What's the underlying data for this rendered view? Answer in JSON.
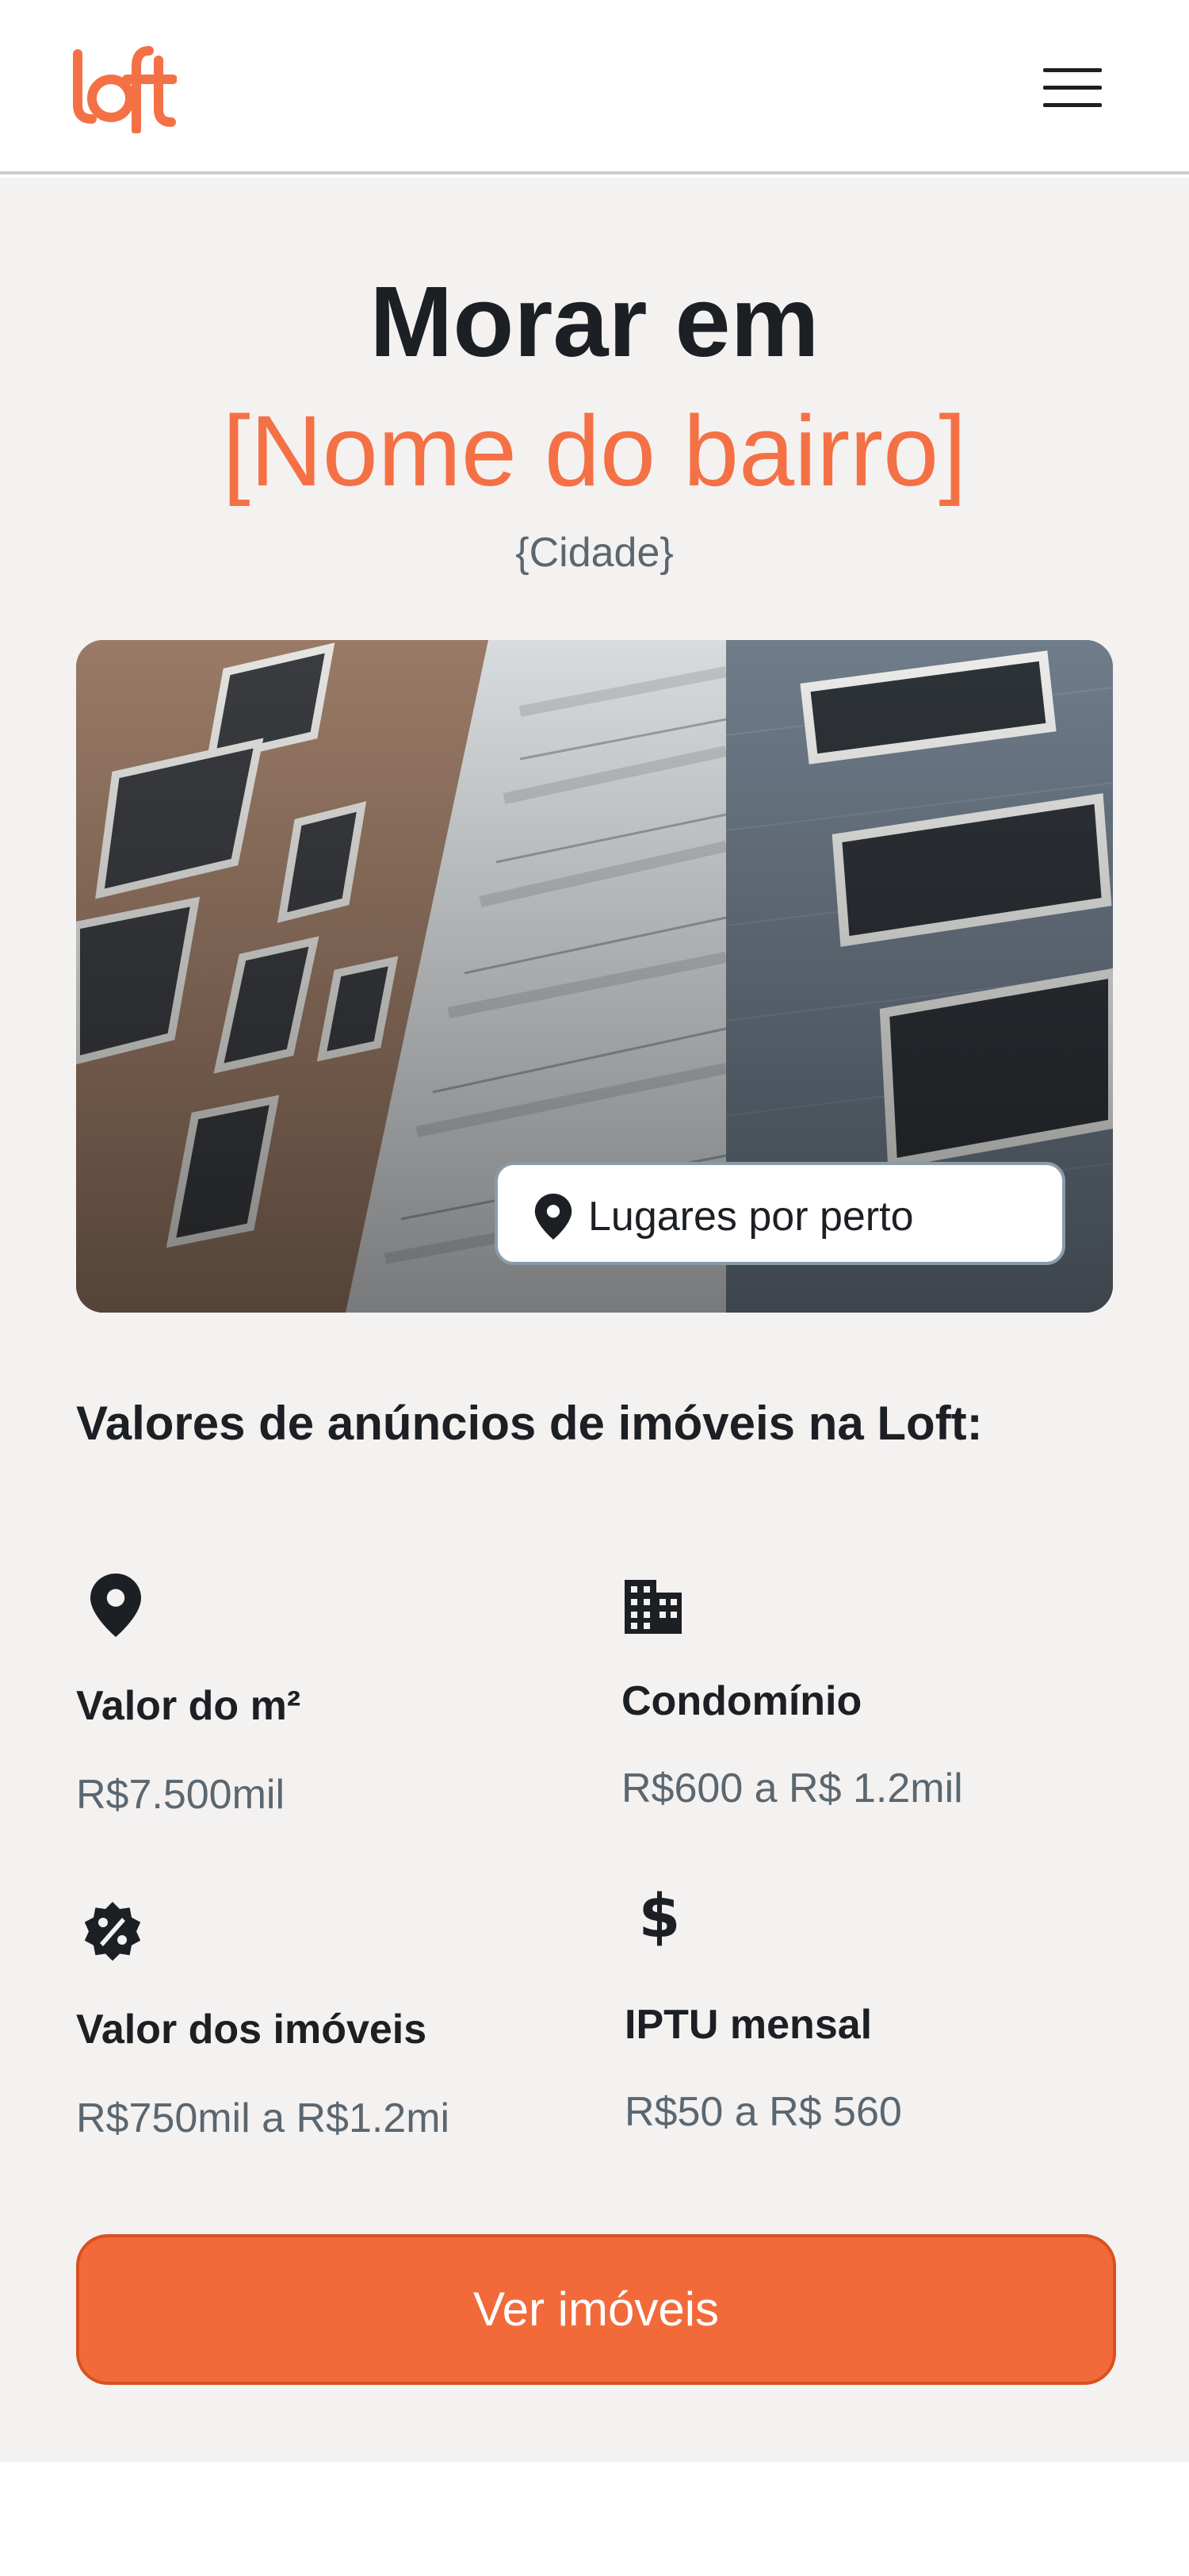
{
  "header": {
    "logo_alt": "loft",
    "menu_icon": "hamburger-menu-icon"
  },
  "hero": {
    "title_prefix": "Morar em",
    "neighborhood": "[Nome do bairro]",
    "city": "{Cidade}"
  },
  "photo": {
    "nearby_label": "Lugares por perto",
    "nearby_icon": "location-pin-icon"
  },
  "values": {
    "heading": "Valores de anúncios de imóveis na Loft:",
    "stats": [
      {
        "icon": "location-pin-icon",
        "label": "Valor do m²",
        "value": "R$7.500mil"
      },
      {
        "icon": "building-icon",
        "label": "Condomínio",
        "value": "R$600 a R$ 1.2mil"
      },
      {
        "icon": "discount-badge-icon",
        "label": "Valor dos imóveis",
        "value": "R$750mil a R$1.2mi"
      },
      {
        "icon": "dollar-icon",
        "label": "IPTU mensal",
        "value": "R$50 a R$ 560"
      }
    ]
  },
  "cta": {
    "label": "Ver imóveis"
  },
  "colors": {
    "brand_orange": "#f47145",
    "cta_orange": "#f26a3a",
    "page_background": "#f4f1f1",
    "text_dark": "#1c1f23",
    "text_muted": "#5a6770"
  }
}
